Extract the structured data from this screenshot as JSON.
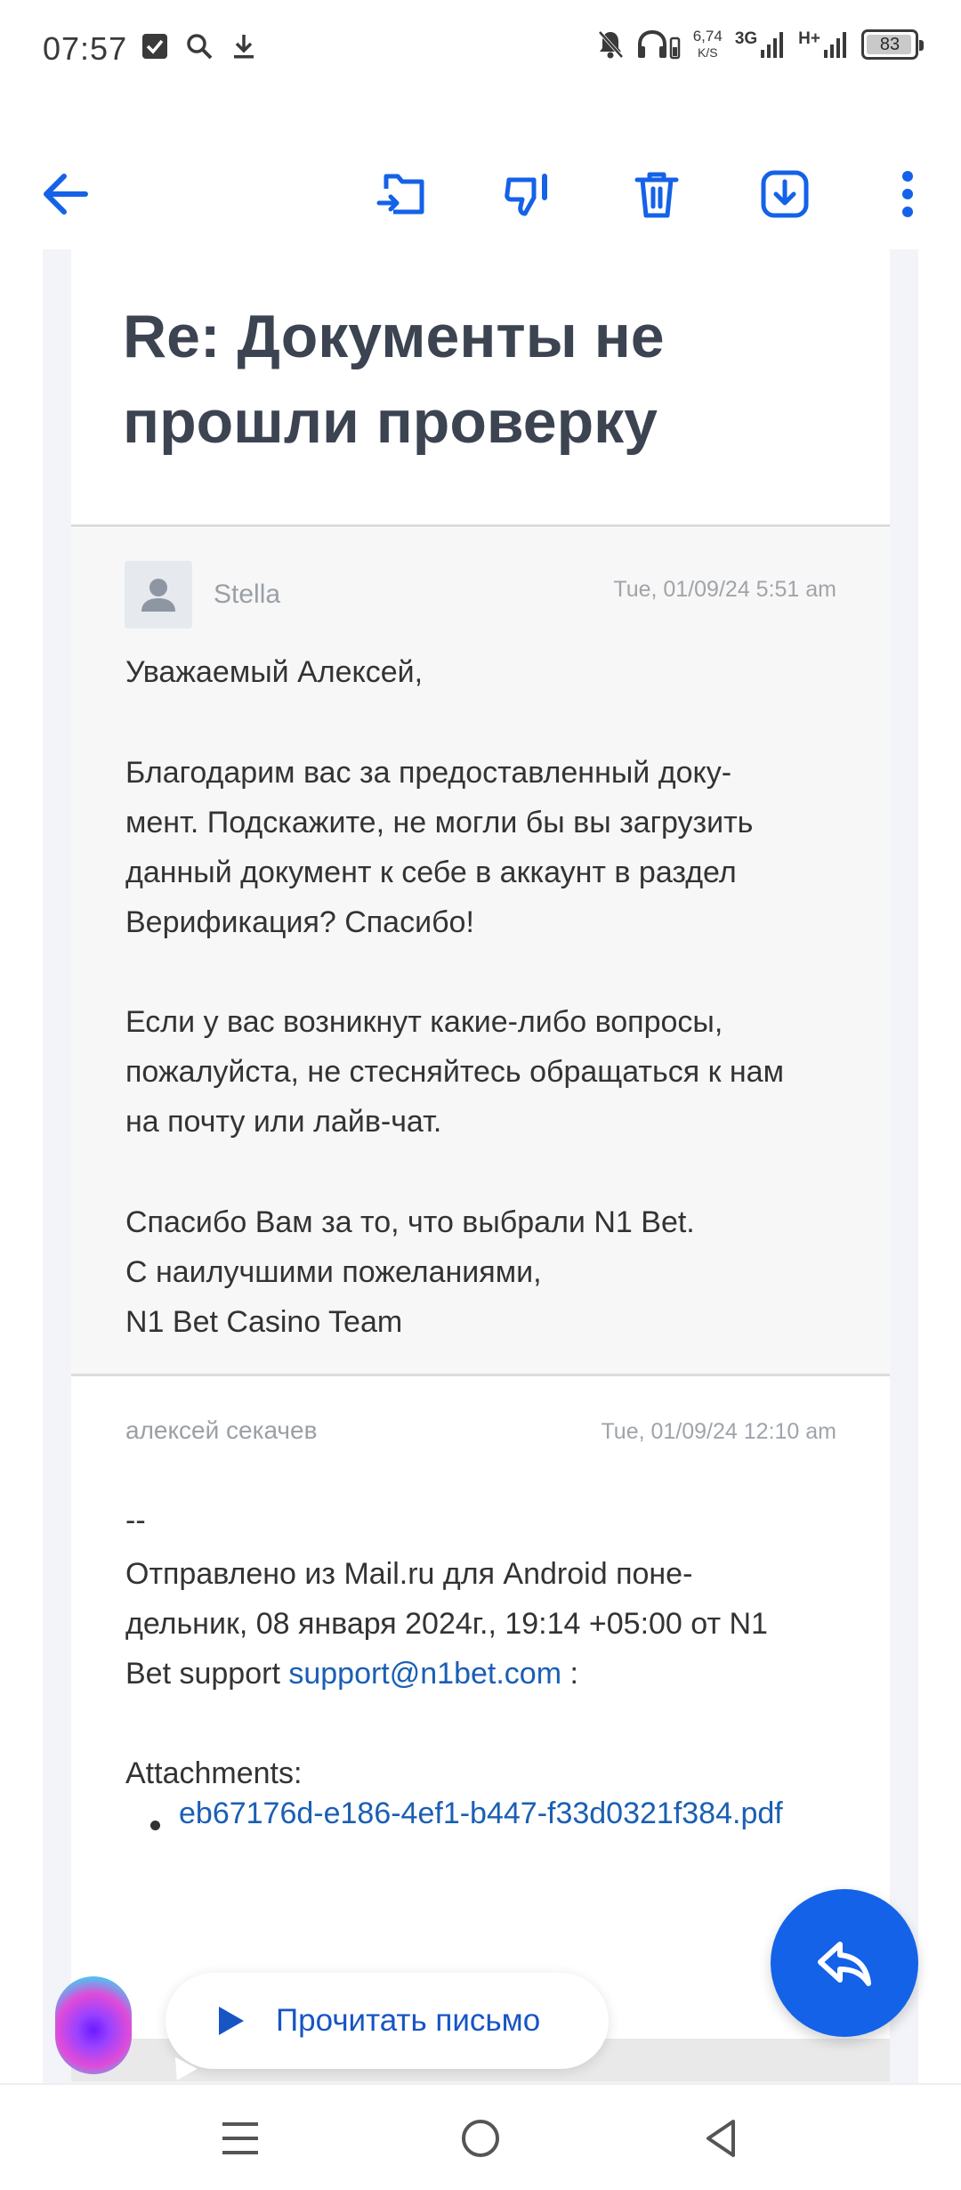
{
  "status_bar": {
    "time": "07:57",
    "net_speed_value": "6,74",
    "net_speed_unit": "K/S",
    "net_type_1": "3G",
    "net_type_2": "H+",
    "battery": "83"
  },
  "toolbar": {
    "back_icon": "arrow-left-icon",
    "move_icon": "folder-move-icon",
    "spam_icon": "thumbs-down-icon",
    "delete_icon": "trash-icon",
    "archive_icon": "download-box-icon",
    "more_icon": "more-vertical-icon",
    "accent": "#1462e8"
  },
  "email": {
    "subject": "Re: Документы не прошли проверку",
    "messages": [
      {
        "sender": "Stella",
        "date": "Tue, 01/09/24 5:51 am",
        "greeting": "Уважаемый Алексей,",
        "paragraph_1": "Благодарим вас за предоставленный доку-\nмент. Подскажите, не могли бы вы загрузить\nданный документ к себе в аккаунт в раздел\nВерификация? Спасибо!",
        "paragraph_2": "Если у вас возникнут какие-либо вопросы,\nпожалуйста, не стесняйтесь обращаться к нам\nна почту или лайв-чат.",
        "signature": "Спасибо Вам за то, что выбрали N1 Bet.\nС наилучшими пожеланиями,\nN1 Bet Casino Team"
      },
      {
        "sender": "алексей секачев",
        "date": "Tue, 01/09/24 12:10 am",
        "separator": "--",
        "sent_from": "Отправлено из Mail.ru для Android поне-\nдельник, 08 января 2024г., 19:14 +05:00 от N1",
        "sent_from_tail_prefix": "Bet support ",
        "sent_from_email": "support@n1bet.com",
        "sent_from_tail_suffix": " :",
        "attachments_label": "Attachments:",
        "attachments": [
          "eb67176d-e186-4ef1-b447-f33d0321f384.pdf"
        ]
      }
    ]
  },
  "read_aloud": {
    "label": "Прочитать письмо",
    "play_icon": "play-icon"
  },
  "fab": {
    "icon": "reply-icon"
  },
  "nav_bar": {
    "recents_icon": "menu-lines-icon",
    "home_icon": "home-circle-icon",
    "back_icon": "triangle-back-icon"
  }
}
